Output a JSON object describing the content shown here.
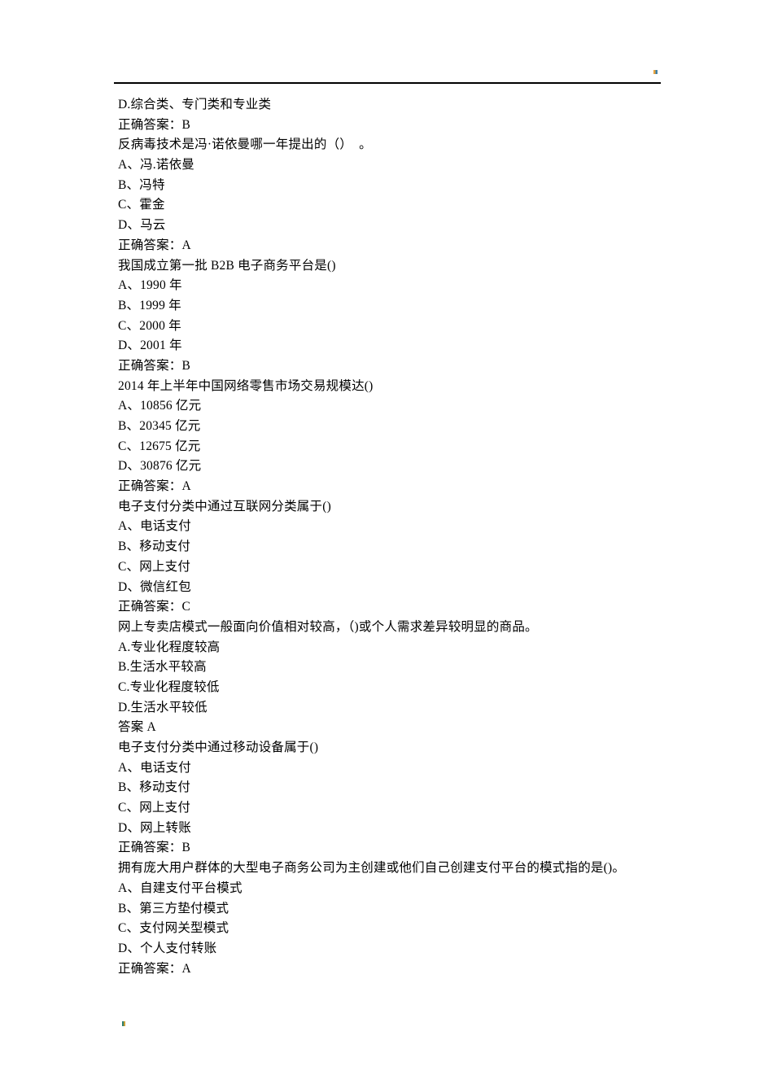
{
  "page": {
    "header_mark": "color-artifact-mark",
    "footer_mark": "color-artifact-mark"
  },
  "document": {
    "lines": [
      {
        "kind": "option",
        "text": "D.综合类、专门类和专业类"
      },
      {
        "kind": "answer",
        "text": "正确答案：B"
      },
      {
        "kind": "question",
        "text": "反病毒技术是冯·诺依曼哪一年提出的（）  。"
      },
      {
        "kind": "option",
        "text": "A、冯.诺依曼"
      },
      {
        "kind": "option",
        "text": "B、冯特"
      },
      {
        "kind": "option",
        "text": "C、霍金"
      },
      {
        "kind": "option",
        "text": "D、马云"
      },
      {
        "kind": "answer",
        "text": "正确答案：A"
      },
      {
        "kind": "question",
        "text": "我国成立第一批 B2B 电子商务平台是()"
      },
      {
        "kind": "option",
        "text": "A、1990 年"
      },
      {
        "kind": "option",
        "text": "B、1999 年"
      },
      {
        "kind": "option",
        "text": "C、2000 年"
      },
      {
        "kind": "option",
        "text": "D、2001 年"
      },
      {
        "kind": "answer",
        "text": "正确答案：B"
      },
      {
        "kind": "question",
        "text": "2014 年上半年中国网络零售市场交易规模达()"
      },
      {
        "kind": "option",
        "text": "A、10856 亿元"
      },
      {
        "kind": "option",
        "text": "B、20345 亿元"
      },
      {
        "kind": "option",
        "text": "C、12675 亿元"
      },
      {
        "kind": "option",
        "text": "D、30876 亿元"
      },
      {
        "kind": "answer",
        "text": "正确答案：A"
      },
      {
        "kind": "question",
        "text": "电子支付分类中通过互联网分类属于()"
      },
      {
        "kind": "option",
        "text": "A、电话支付"
      },
      {
        "kind": "option",
        "text": "B、移动支付"
      },
      {
        "kind": "option",
        "text": "C、网上支付"
      },
      {
        "kind": "option",
        "text": "D、微信红包"
      },
      {
        "kind": "answer",
        "text": "正确答案：C"
      },
      {
        "kind": "question",
        "text": "网上专卖店模式一般面向价值相对较高，（)或个人需求差异较明显的商品。"
      },
      {
        "kind": "option",
        "text": "A.专业化程度较高"
      },
      {
        "kind": "option",
        "text": "B.生活水平较高"
      },
      {
        "kind": "option",
        "text": "C.专业化程度较低"
      },
      {
        "kind": "option",
        "text": "D.生活水平较低"
      },
      {
        "kind": "answer",
        "text": "答案 A"
      },
      {
        "kind": "question",
        "text": "电子支付分类中通过移动设备属于()"
      },
      {
        "kind": "option",
        "text": "A、电话支付"
      },
      {
        "kind": "option",
        "text": "B、移动支付"
      },
      {
        "kind": "option",
        "text": "C、网上支付"
      },
      {
        "kind": "option",
        "text": "D、网上转账"
      },
      {
        "kind": "answer",
        "text": "正确答案：B"
      },
      {
        "kind": "question",
        "text": "拥有庞大用户群体的大型电子商务公司为主创建或他们自己创建支付平台的模式指的是()。"
      },
      {
        "kind": "option",
        "text": "A、自建支付平台模式"
      },
      {
        "kind": "option",
        "text": "B、第三方垫付模式"
      },
      {
        "kind": "option",
        "text": "C、支付网关型模式"
      },
      {
        "kind": "option",
        "text": "D、个人支付转账"
      },
      {
        "kind": "answer",
        "text": "正确答案：A"
      }
    ]
  }
}
